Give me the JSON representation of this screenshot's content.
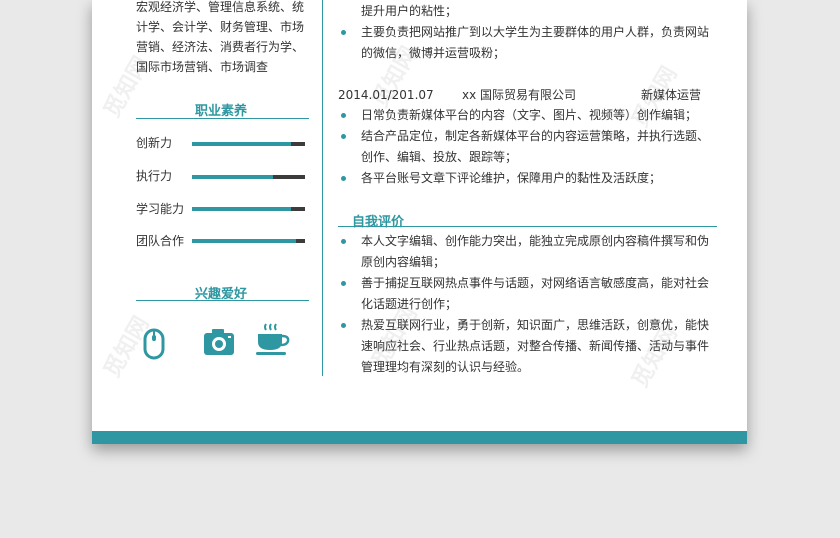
{
  "colors": {
    "accent": "#2f97a1",
    "text": "#333333",
    "track": "#3c3c3c",
    "background": "#e9e9e9"
  },
  "left": {
    "courses_lines": [
      "宏观经济学、管理信息系统、统",
      "计学、会计学、财务管理、市场",
      "营销、经济法、消费者行为学、",
      "国际市场营销、市场调查"
    ],
    "skills_heading": "职业素养",
    "skills": [
      {
        "label": "创新力",
        "level": 0.88
      },
      {
        "label": "执行力",
        "level": 0.72
      },
      {
        "label": "学习能力",
        "level": 0.88
      },
      {
        "label": "团队合作",
        "level": 0.92
      }
    ],
    "hobbies_heading": "兴趣爱好",
    "hobby_icons": [
      "mouse-icon",
      "camera-icon",
      "coffee-cup-icon"
    ]
  },
  "right": {
    "exp1_lines": [
      {
        "text": "提升用户的粘性；",
        "bullet": false
      },
      {
        "text": "主要负责把网站推广到以大学生为主要群体的用户人群，负责网站",
        "bullet": true
      },
      {
        "text": "的微信，微博并运营吸粉；",
        "bullet": false
      }
    ],
    "exp2": {
      "date": "2014.01/201.07",
      "company": "xx 国际贸易有限公司",
      "role": "新媒体运营"
    },
    "exp2_lines": [
      {
        "text": "日常负责新媒体平台的内容（文字、图片、视频等）创作编辑；",
        "bullet": true
      },
      {
        "text": "结合产品定位，制定各新媒体平台的内容运营策略，并执行选题、",
        "bullet": true
      },
      {
        "text": "创作、编辑、投放、跟踪等；",
        "bullet": false
      },
      {
        "text": "各平台账号文章下评论维护，保障用户的黏性及活跃度；",
        "bullet": true
      }
    ],
    "self_heading": "自我评价",
    "self_lines": [
      {
        "text": "本人文字编辑、创作能力突出，能独立完成原创内容稿件撰写和伪",
        "bullet": true
      },
      {
        "text": "原创内容编辑；",
        "bullet": false
      },
      {
        "text": "善于捕捉互联网热点事件与话题，对网络语言敏感度高，能对社会",
        "bullet": true
      },
      {
        "text": "化话题进行创作；",
        "bullet": false
      },
      {
        "text": "热爱互联网行业，勇于创新，知识面广，思维活跃，创意优，能快",
        "bullet": true
      },
      {
        "text": "速响应社会、行业热点话题，对整合传播、新闻传播、活动与事件",
        "bullet": false
      },
      {
        "text": "管理理均有深刻的认识与经验。",
        "bullet": false
      }
    ]
  },
  "watermark_text": "觅知网"
}
